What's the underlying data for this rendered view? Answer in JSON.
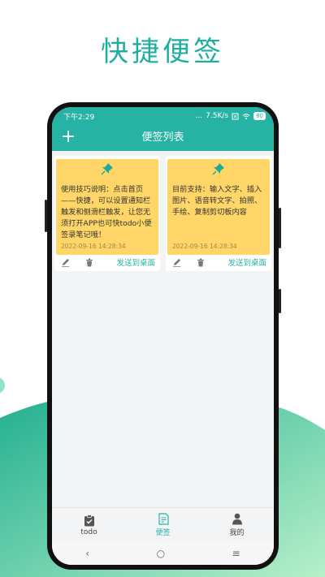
{
  "promo": {
    "title": "快捷便签"
  },
  "status_bar": {
    "time": "下午2:29",
    "signal": "...",
    "speed": "7.5K/s",
    "battery": "80"
  },
  "header": {
    "title": "便签列表",
    "add_label": "+"
  },
  "notes": [
    {
      "text": "使用技巧说明：点击首页——快捷，可以设置通知栏触发和侧滑栏触发，让您无须打开APP也可快todo小便签录笔记哦！",
      "date": "2022-09-16 14:28:34",
      "send_label": "发送到桌面"
    },
    {
      "text": "目前支持：输入文字、插入图片、语音转文字、拍照、手绘、复制剪切板内容",
      "date": "2022-09-16 14:28:34",
      "send_label": "发送到桌面"
    }
  ],
  "bottom_nav": [
    {
      "label": "todo",
      "icon": "clipboard-icon",
      "active": false
    },
    {
      "label": "便签",
      "icon": "note-icon",
      "active": true
    },
    {
      "label": "我的",
      "icon": "person-icon",
      "active": false
    }
  ],
  "sys_nav": {
    "back": "‹",
    "home": "○",
    "menu": "≡"
  },
  "colors": {
    "accent": "#27b3a3",
    "note": "#ffd667",
    "promo_title": "#1fae9f"
  }
}
